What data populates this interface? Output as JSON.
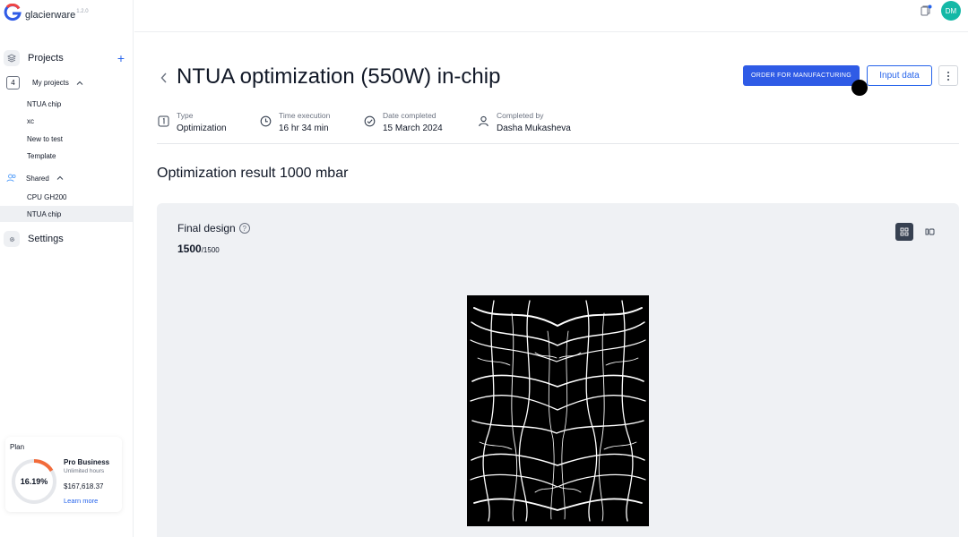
{
  "app": {
    "name": "glacierware",
    "version": "1.2.0"
  },
  "sidebar": {
    "projects_label": "Projects",
    "my_projects_count": "4",
    "my_projects_label": "My projects",
    "my_projects": [
      "NTUA chip",
      "xc",
      "New to test",
      "Template"
    ],
    "shared_label": "Shared",
    "shared_projects": [
      "CPU GH200",
      "NTUA chip"
    ],
    "settings_label": "Settings"
  },
  "plan": {
    "label": "Plan",
    "percent_text": "16.19%",
    "percent_value": 16.19,
    "name": "Pro Business",
    "hours": "Unlimited hours",
    "amount": "$167,618.37",
    "link": "Learn more"
  },
  "user": {
    "initials": "DM"
  },
  "header": {
    "title": "NTUA optimization (550W) in-chip",
    "order_button": "ORDER FOR MANUFACTURING",
    "input_button": "Input data"
  },
  "meta": {
    "type_label": "Type",
    "type_value": "Optimization",
    "time_label": "Time execution",
    "time_value": "16 hr 34 min",
    "date_label": "Date completed",
    "date_value": "15 March 2024",
    "by_label": "Completed by",
    "by_value": "Dasha Mukasheva"
  },
  "result": {
    "section_title": "Optimization result 1000 mbar",
    "panel_title": "Final design",
    "count": "1500",
    "count_total": "/1500"
  },
  "colors": {
    "accent": "#2f5be6",
    "avatar": "#14b8a6",
    "plan_arc": "#f26b3a"
  }
}
